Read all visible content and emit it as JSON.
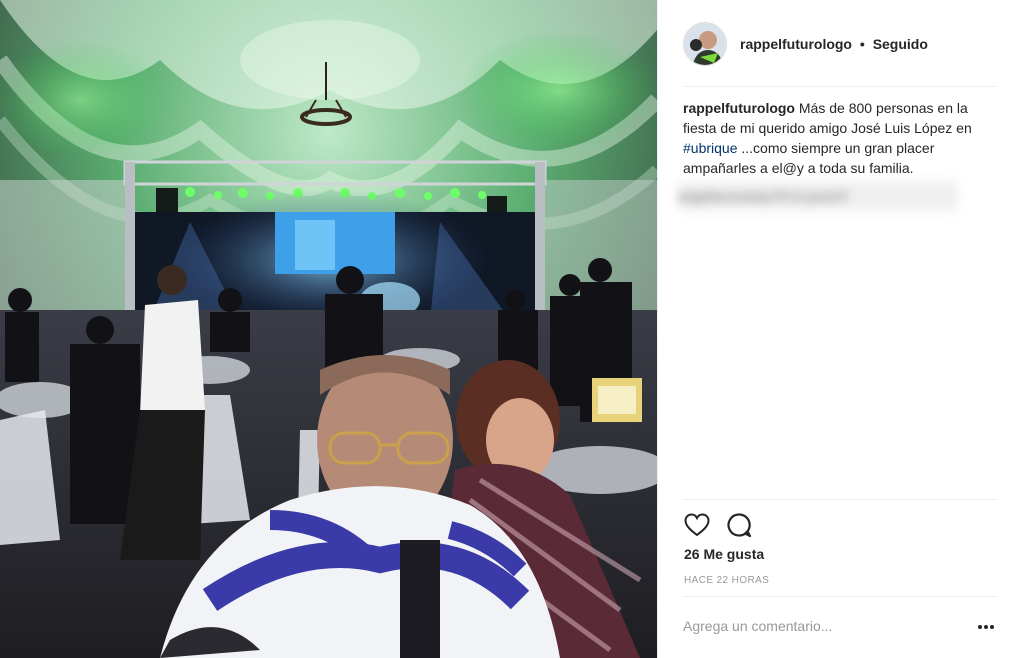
{
  "post": {
    "username": "rappelfuturologo",
    "separator": "•",
    "follow_state": "Seguido",
    "caption_text": "Más de 800 personas en la fiesta de mi querido amigo José Luis López en ",
    "caption_hashtag": "#ubrique",
    "caption_rest": " ...como siempre un gran placer ampañarles a el@y a toda su familia.",
    "blurred_comment": "angelacoussau76 lo puso!!!",
    "likes": "26 Me gusta",
    "timestamp": "HACE 22 HORAS",
    "comment_placeholder": "Agrega un comentario...",
    "more_icon": "ellipsis-icon",
    "like_icon": "heart-icon",
    "comment_icon": "comment-bubble-icon"
  }
}
